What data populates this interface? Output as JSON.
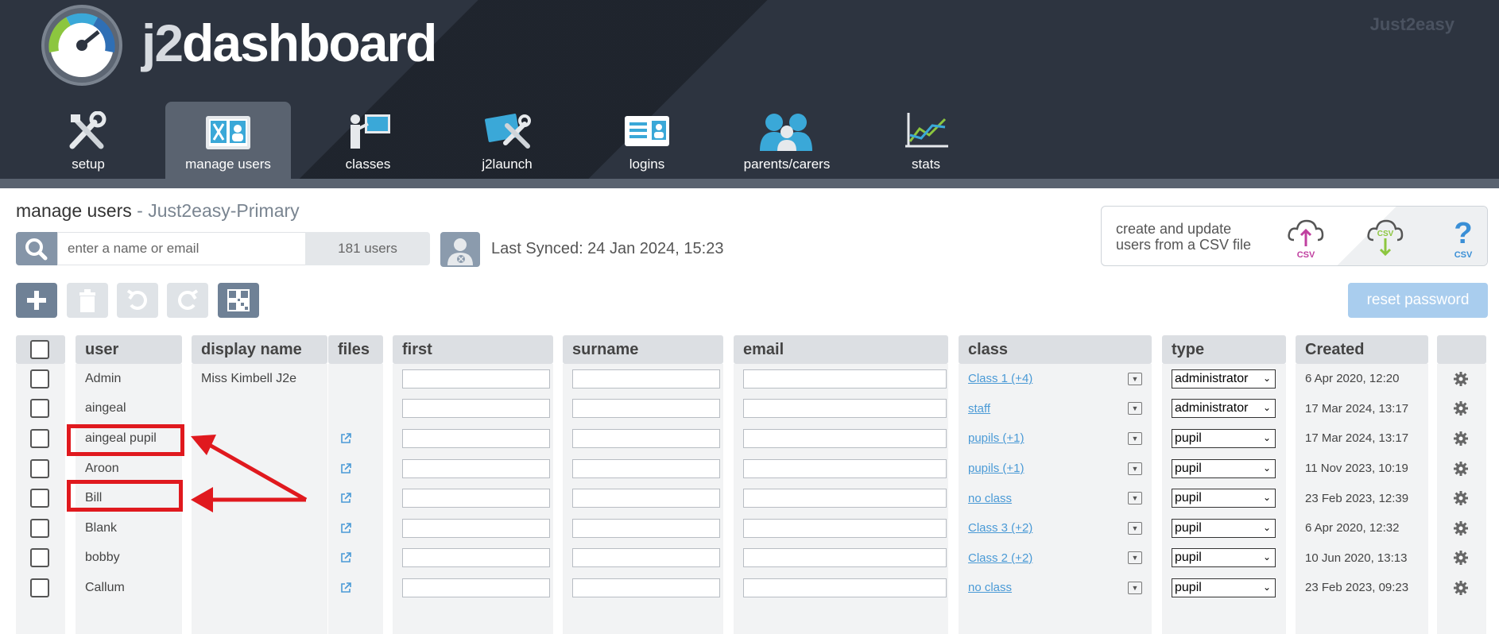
{
  "header": {
    "logo_prefix": "j2",
    "logo_suffix": "dashboard",
    "brand": "Just2easy"
  },
  "nav": [
    {
      "label": "setup",
      "icon": "tools-icon"
    },
    {
      "label": "manage users",
      "icon": "manage-users-icon",
      "active": true
    },
    {
      "label": "classes",
      "icon": "classes-icon"
    },
    {
      "label": "j2launch",
      "icon": "j2launch-icon"
    },
    {
      "label": "logins",
      "icon": "logins-icon"
    },
    {
      "label": "parents/carers",
      "icon": "parents-icon"
    },
    {
      "label": "stats",
      "icon": "stats-icon"
    }
  ],
  "page": {
    "title": "manage users",
    "separator": " - ",
    "school": "Just2easy-Primary"
  },
  "search": {
    "placeholder": "enter a name or email",
    "count": "181 users"
  },
  "sync": {
    "text": "Last Synced: 24 Jan 2024, 15:23"
  },
  "csv": {
    "line1": "create and update",
    "line2": "users from a CSV file",
    "icon_label": "CSV"
  },
  "toolbar": {
    "reset_password": "reset password"
  },
  "table": {
    "headers": {
      "user": "user",
      "display_name": "display name",
      "files": "files",
      "first": "first",
      "surname": "surname",
      "email": "email",
      "class": "class",
      "type": "type",
      "created": "Created"
    },
    "rows": [
      {
        "user": "Admin",
        "display_name": "Miss Kimbell J2e",
        "files": false,
        "class": "Class 1 (+4)",
        "type": "administrator",
        "created": "6 Apr 2020, 12:20"
      },
      {
        "user": "aingeal",
        "display_name": "",
        "files": false,
        "class": "staff",
        "type": "administrator",
        "created": "17 Mar 2024, 13:17"
      },
      {
        "user": "aingeal pupil",
        "display_name": "",
        "files": true,
        "class": "pupils (+1)",
        "type": "pupil",
        "created": "17 Mar 2024, 13:17"
      },
      {
        "user": "Aroon",
        "display_name": "",
        "files": true,
        "class": "pupils (+1)",
        "type": "pupil",
        "created": "11 Nov 2023, 10:19"
      },
      {
        "user": "Bill",
        "display_name": "",
        "files": true,
        "class": "no class",
        "type": "pupil",
        "created": "23 Feb 2023, 12:39"
      },
      {
        "user": "Blank",
        "display_name": "",
        "files": true,
        "class": "Class 3 (+2)",
        "type": "pupil",
        "created": "6 Apr 2020, 12:32"
      },
      {
        "user": "bobby",
        "display_name": "",
        "files": true,
        "class": "Class 2 (+2)",
        "type": "pupil",
        "created": "10 Jun 2020, 13:13"
      },
      {
        "user": "Callum",
        "display_name": "",
        "files": true,
        "class": "no class",
        "type": "pupil",
        "created": "23 Feb 2023, 09:23"
      }
    ]
  },
  "colors": {
    "header_bg": "#2d3440",
    "accent": "#4a9ad6",
    "annotation_red": "#e0191e"
  }
}
